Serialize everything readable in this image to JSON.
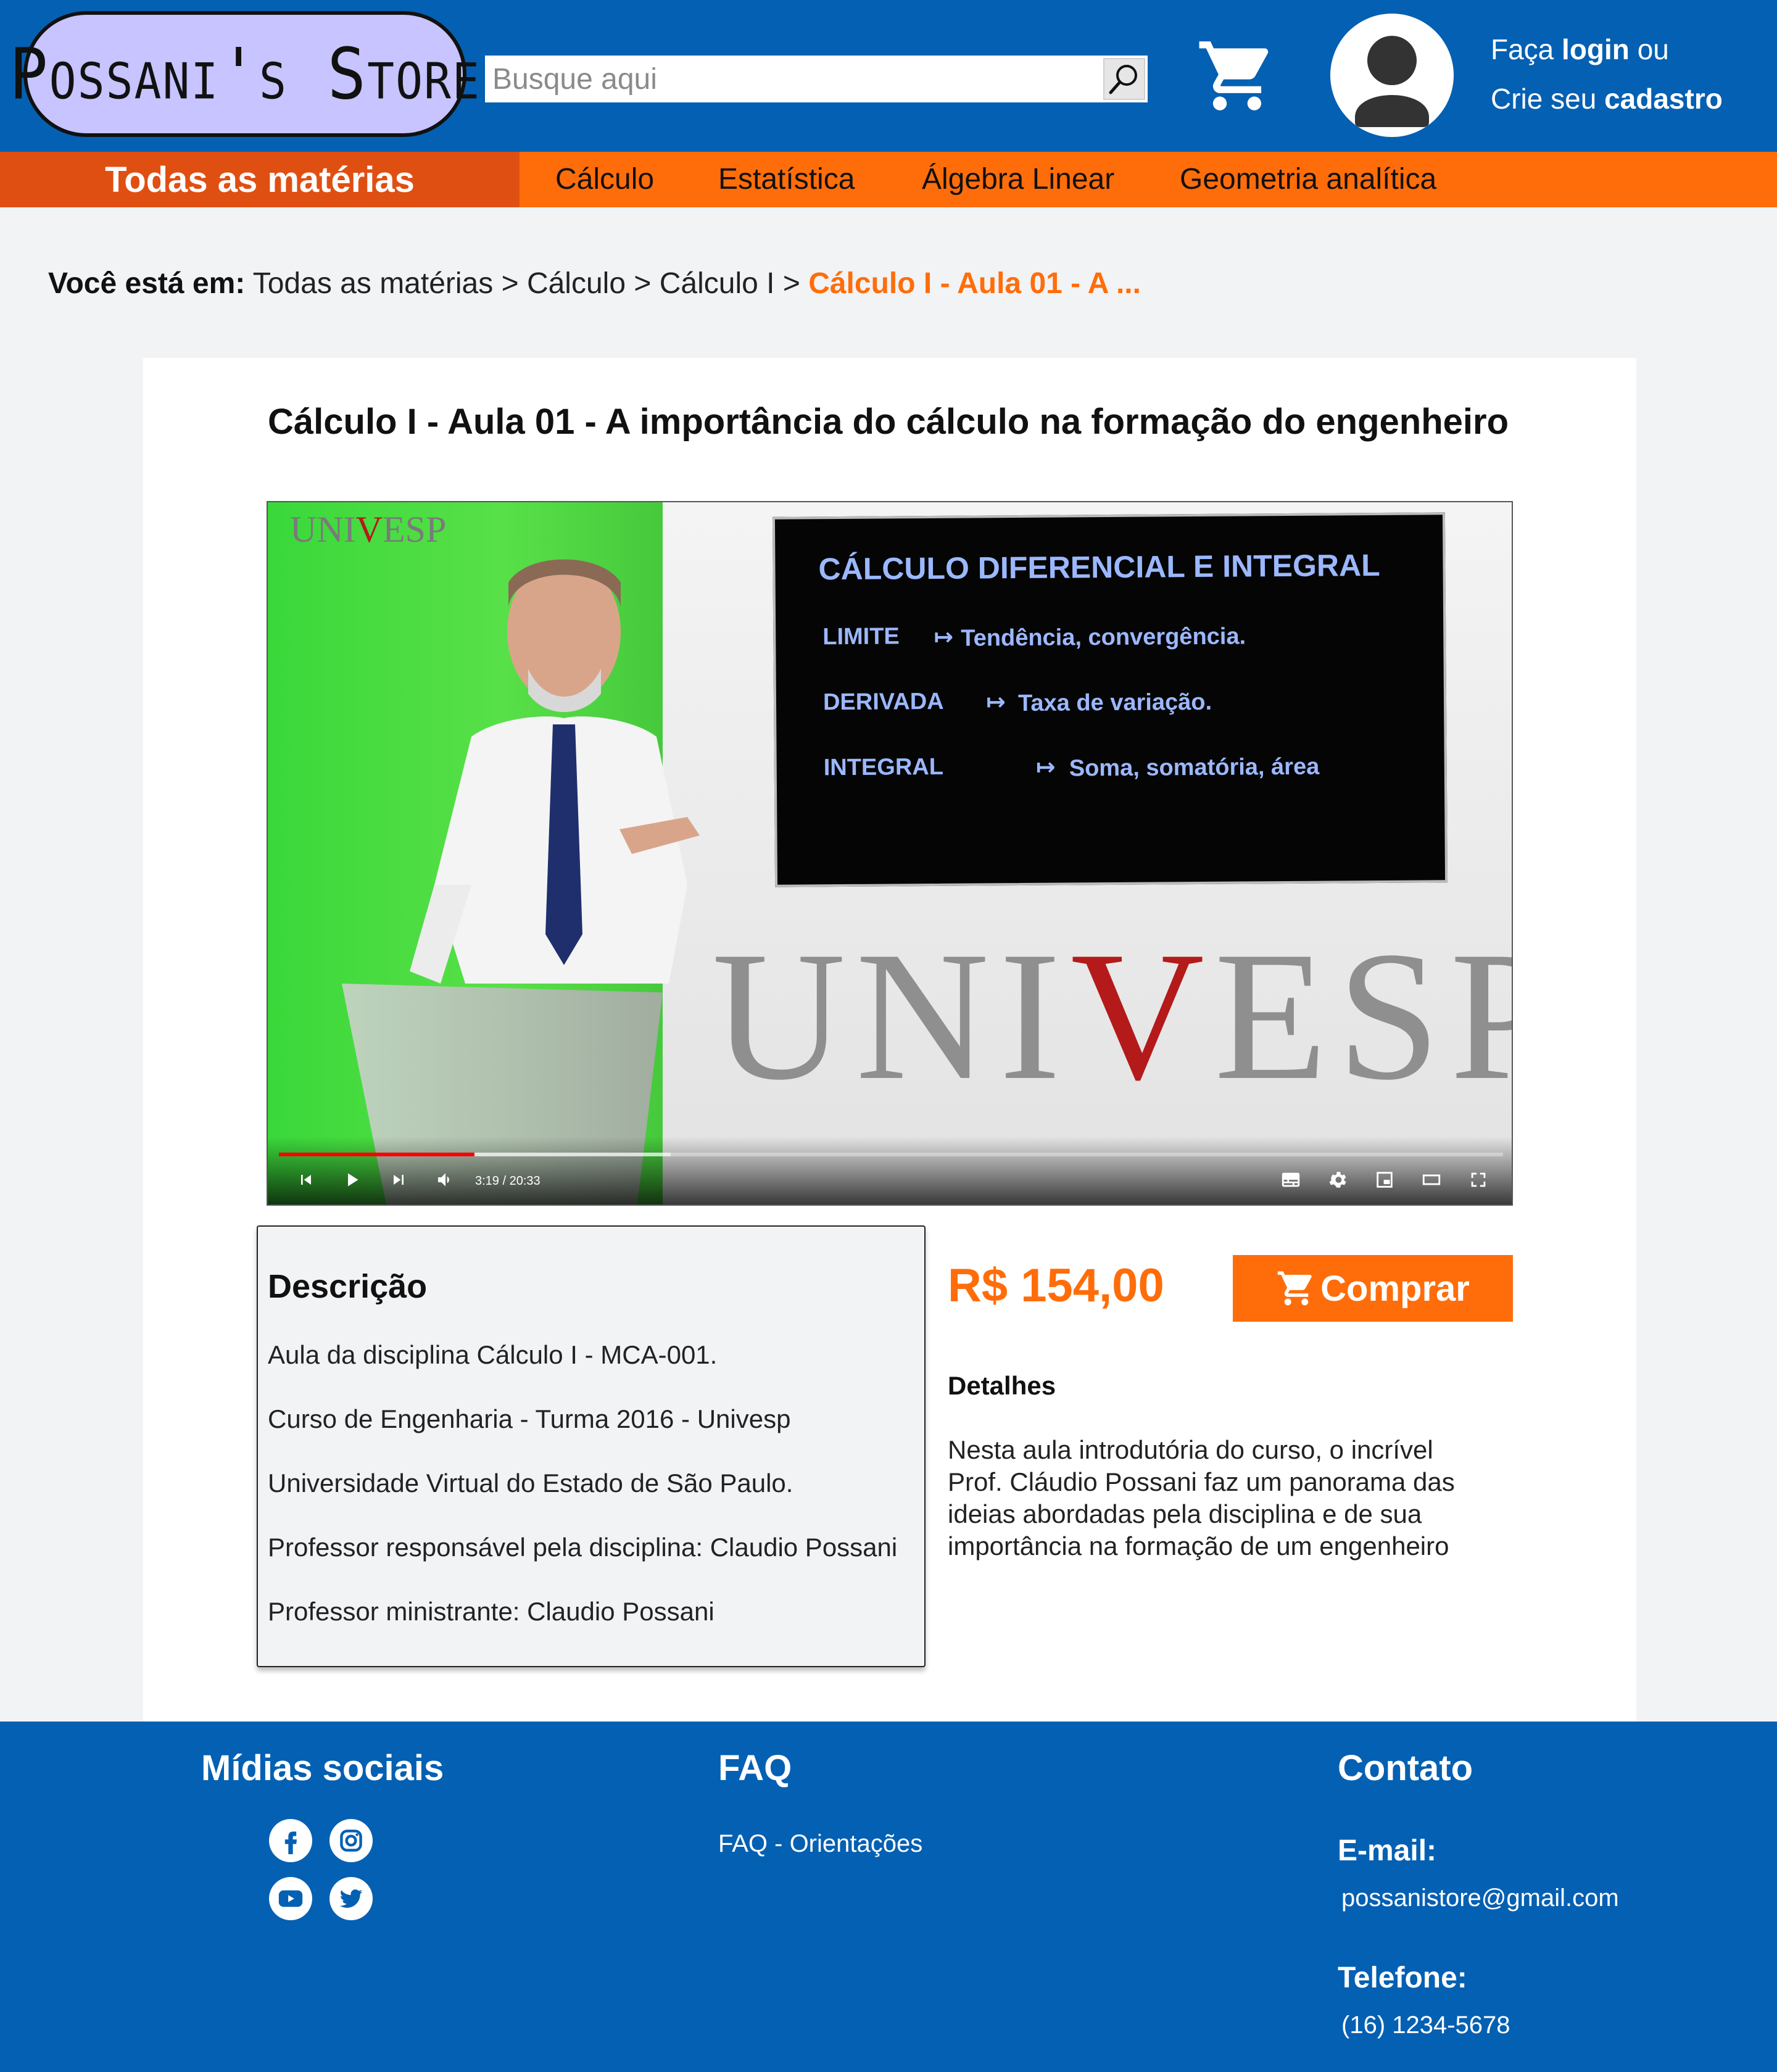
{
  "header": {
    "logo": "Possani's Store",
    "search_placeholder": "Busque aqui",
    "login_prefix": "Faça",
    "login_link": "login",
    "login_suffix": "ou",
    "signup_prefix": "Crie seu",
    "signup_link": "cadastro"
  },
  "nav": {
    "all": "Todas as matérias",
    "items": [
      "Cálculo",
      "Estatística",
      "Álgebra Linear",
      "Geometria analítica"
    ]
  },
  "breadcrumb": {
    "label": "Você está em:",
    "path": "Todas as matérias > Cálculo > Cálculo I >",
    "current": "Cálculo I - Aula 01 - A ..."
  },
  "product": {
    "title": "Cálculo I - Aula 01 - A importância do cálculo na formação do engenheiro",
    "price": "R$ 154,00",
    "buy_label": "Comprar",
    "details_title": "Detalhes",
    "details_text": "Nesta aula introdutória do curso, o incrível Prof. Cláudio Possani faz um panorama das ideias abordadas pela disciplina e de sua importância na formação de um engenheiro"
  },
  "video": {
    "slide_title": "CÁLCULO DIFERENCIAL E INTEGRAL",
    "slide_rows": [
      {
        "term": "LIMITE",
        "arrow": "↦",
        "meaning": "Tendência, convergência."
      },
      {
        "term": "DERIVADA",
        "arrow": "↦",
        "meaning": "Taxa de variação."
      },
      {
        "term": "INTEGRAL",
        "arrow": "↦",
        "meaning": "Soma, somatória, área"
      }
    ],
    "brand_left": "UNI",
    "brand_v": "V",
    "brand_right": "ESP",
    "watermark_left": "UNI",
    "watermark_v": "V",
    "watermark_right": "ESP",
    "time": "3:19 / 20:33",
    "progress_played": 0.16,
    "progress_buffered": 0.32
  },
  "description": {
    "title": "Descrição",
    "lines": [
      "Aula da disciplina Cálculo I - MCA-001.",
      "Curso de Engenharia - Turma 2016 -  Univesp",
      "Universidade Virtual do Estado de São Paulo.",
      "Professor responsável pela disciplina: Claudio Possani",
      "Professor ministrante: Claudio Possani"
    ]
  },
  "footer": {
    "social_title": "Mídias sociais",
    "social_icons": [
      "facebook-icon",
      "instagram-icon",
      "youtube-icon",
      "twitter-icon"
    ],
    "faq_title": "FAQ",
    "faq_link": "FAQ - Orientações",
    "contact_title": "Contato",
    "email_label": "E-mail:",
    "email": "possanistore@gmail.com",
    "phone_label": "Telefone:",
    "phone": "(16) 1234-5678"
  },
  "colors": {
    "primary_blue": "#0460b2",
    "accent_orange": "#ff6d0a",
    "nav_dark_orange": "#e04f12",
    "logo_bg": "#c7c4ff"
  }
}
